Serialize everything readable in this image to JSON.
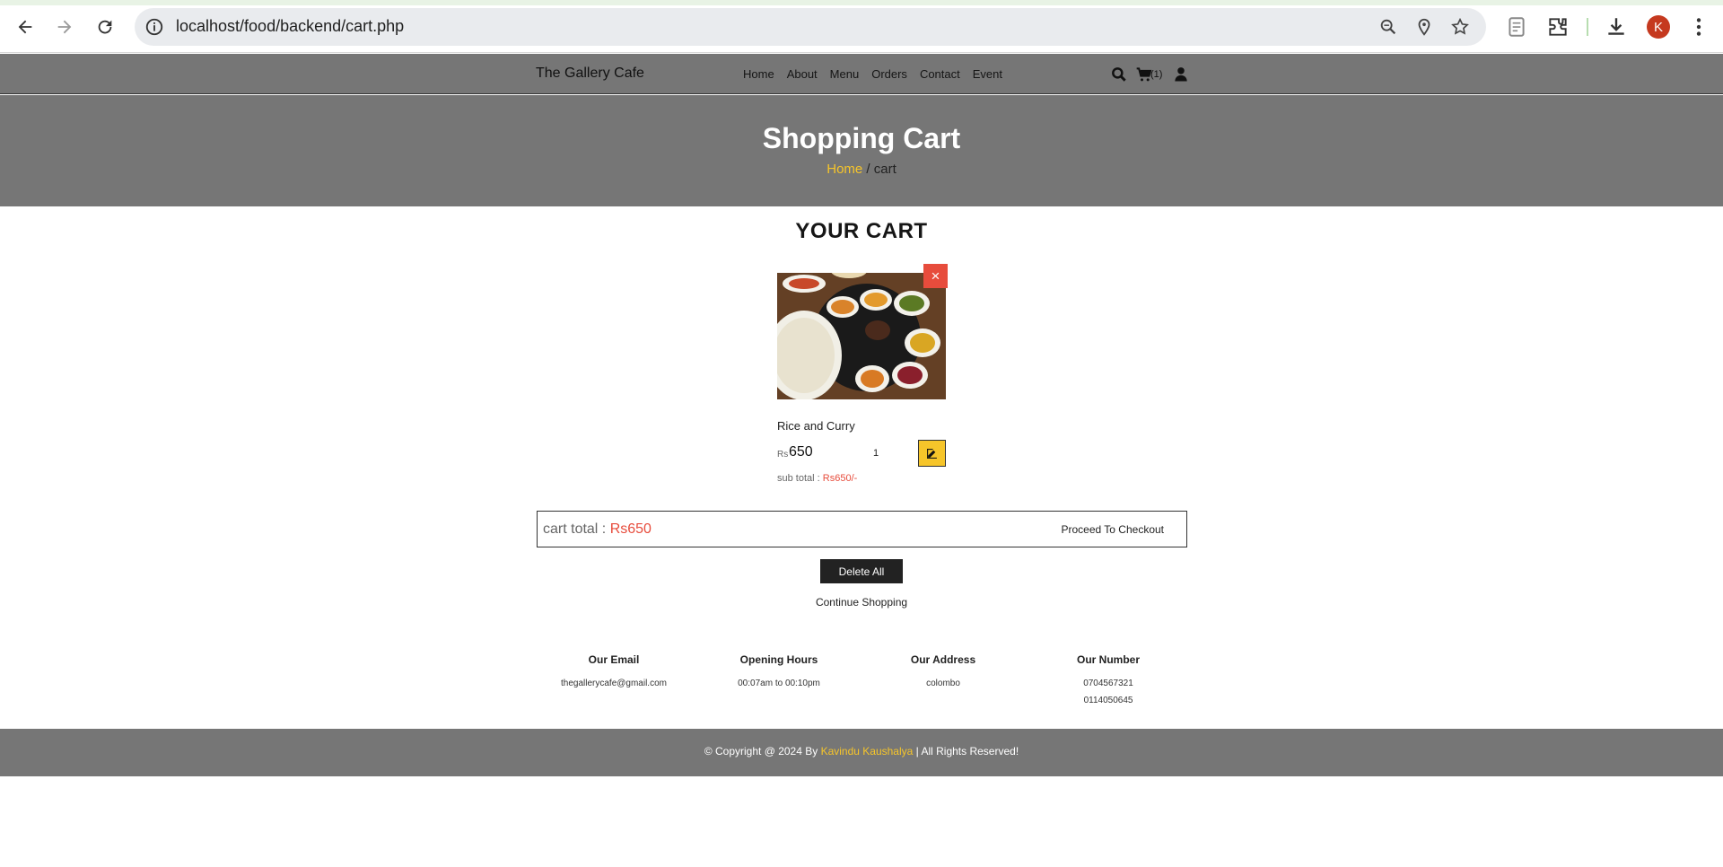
{
  "browser": {
    "url": "localhost/food/backend/cart.php",
    "avatar_letter": "K"
  },
  "header": {
    "brand": "The Gallery Cafe",
    "nav": [
      "Home",
      "About",
      "Menu",
      "Orders",
      "Contact",
      "Event"
    ],
    "cart_count": "(1)"
  },
  "banner": {
    "title": "Shopping Cart",
    "breadcrumb_home": "Home",
    "breadcrumb_rest": " / cart"
  },
  "cart": {
    "heading": "YOUR CART",
    "item": {
      "name": "Rice and Curry",
      "currency": "Rs",
      "price": "650",
      "quantity": "1",
      "subtotal_label": "sub total : ",
      "subtotal_value": "Rs650/-",
      "remove_symbol": "×"
    },
    "total_label": "cart total : ",
    "total_value": "Rs650",
    "checkout_label": "Proceed To Checkout",
    "delete_all_label": "Delete All",
    "continue_label": "Continue Shopping"
  },
  "info": {
    "email_heading": "Our Email",
    "email": "thegallerycafe@gmail.com",
    "hours_heading": "Opening Hours",
    "hours": "00:07am to 00:10pm",
    "address_heading": "Our Address",
    "address": "colombo",
    "number_heading": "Our Number",
    "number1": "0704567321",
    "number2": "0114050645"
  },
  "footer": {
    "prefix": "© Copyright @ 2024 By ",
    "author": "Kavindu Kaushalya",
    "suffix": " | All Rights Reserved!"
  },
  "colors": {
    "header_bg": "#767676",
    "accent_yellow": "#f6c52a",
    "accent_red": "#e74c3c"
  }
}
